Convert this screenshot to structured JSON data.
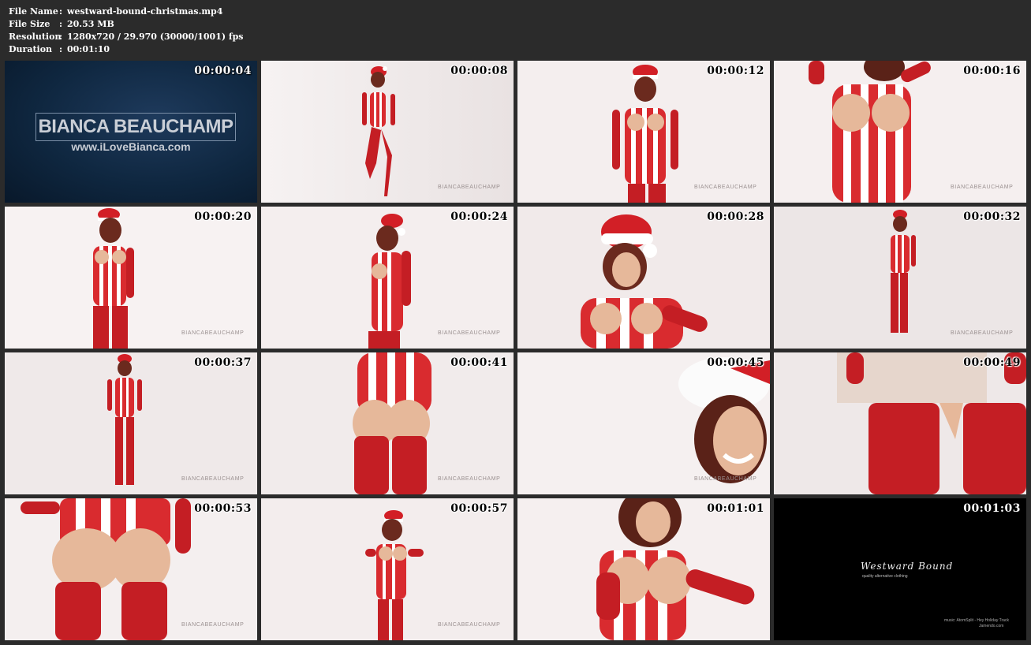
{
  "meta": {
    "file_name_label": "File Name",
    "file_name": "westward-bound-christmas.mp4",
    "file_size_label": "File Size",
    "file_size": "20.53 MB",
    "resolution_label": "Resolution",
    "resolution": "1280x720 / 29.970 (30000/1001) fps",
    "duration_label": "Duration",
    "duration": "00:01:10",
    "separator": ":"
  },
  "title_card": {
    "brand": "BIANCA BEAUCHAMP",
    "url": "www.iLoveBianca.com"
  },
  "watermark": "BIANCABEAUCHAMP",
  "end_card": {
    "logo": "Westward Bound",
    "subtitle": "quality alternative clothing",
    "music_line1": "music:  AtomSplit - Hey Holiday Track",
    "music_line2": "Jamendo.com"
  },
  "thumbnails": [
    {
      "time": "00:00:04"
    },
    {
      "time": "00:00:08"
    },
    {
      "time": "00:00:12"
    },
    {
      "time": "00:00:16"
    },
    {
      "time": "00:00:20"
    },
    {
      "time": "00:00:24"
    },
    {
      "time": "00:00:28"
    },
    {
      "time": "00:00:32"
    },
    {
      "time": "00:00:37"
    },
    {
      "time": "00:00:41"
    },
    {
      "time": "00:00:45"
    },
    {
      "time": "00:00:49"
    },
    {
      "time": "00:00:53"
    },
    {
      "time": "00:00:57"
    },
    {
      "time": "00:01:01"
    },
    {
      "time": "00:01:03"
    }
  ]
}
